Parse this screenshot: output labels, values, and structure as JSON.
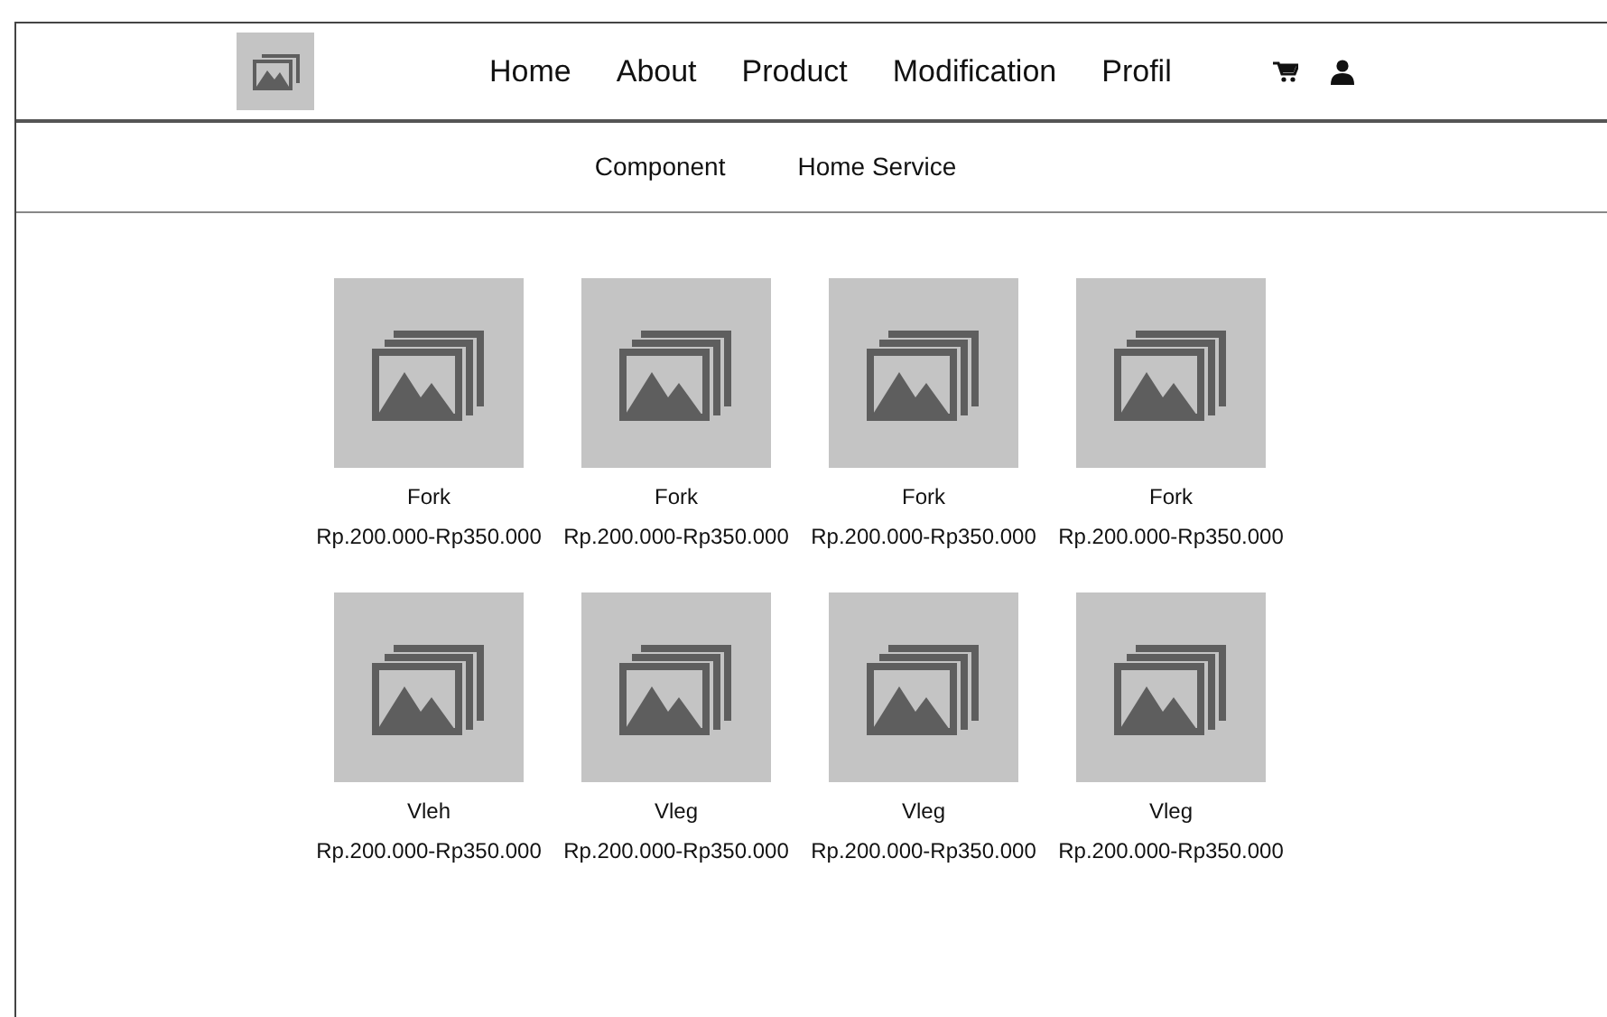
{
  "nav": {
    "links": [
      {
        "label": "Home"
      },
      {
        "label": "About"
      },
      {
        "label": "Product"
      },
      {
        "label": "Modification"
      },
      {
        "label": "Profil"
      }
    ]
  },
  "subnav": {
    "links": [
      {
        "label": "Component"
      },
      {
        "label": "Home Service"
      }
    ]
  },
  "products": [
    {
      "name": "Fork",
      "price": "Rp.200.000-Rp350.000"
    },
    {
      "name": "Fork",
      "price": "Rp.200.000-Rp350.000"
    },
    {
      "name": "Fork",
      "price": "Rp.200.000-Rp350.000"
    },
    {
      "name": "Fork",
      "price": "Rp.200.000-Rp350.000"
    },
    {
      "name": "Vleh",
      "price": "Rp.200.000-Rp350.000"
    },
    {
      "name": "Vleg",
      "price": "Rp.200.000-Rp350.000"
    },
    {
      "name": "Vleg",
      "price": "Rp.200.000-Rp350.000"
    },
    {
      "name": "Vleg",
      "price": "Rp.200.000-Rp350.000"
    }
  ]
}
